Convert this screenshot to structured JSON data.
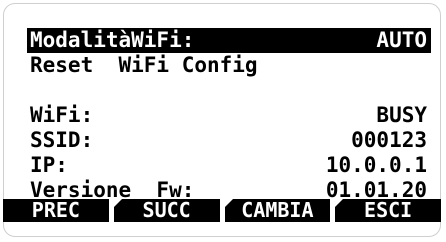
{
  "display": {
    "rows": [
      {
        "label": "ModalitàWiFi:",
        "value": "AUTO",
        "selected": true
      },
      {
        "label": "Reset  WiFi Config",
        "value": ""
      },
      {
        "label": "",
        "value": ""
      },
      {
        "label": "WiFi:",
        "value": "BUSY"
      },
      {
        "label": "SSID:",
        "value": "000123"
      },
      {
        "label": "IP:",
        "value": "10.0.0.1"
      },
      {
        "label": "Versione  Fw:",
        "value": "01.01.20"
      }
    ]
  },
  "softkeys": [
    {
      "label": "PREC"
    },
    {
      "label": "SUCC"
    },
    {
      "label": "CAMBIA"
    },
    {
      "label": "ESCI"
    }
  ],
  "colors": {
    "foreground": "#000000",
    "background": "#ffffff",
    "frame": "#cfcfcf"
  }
}
